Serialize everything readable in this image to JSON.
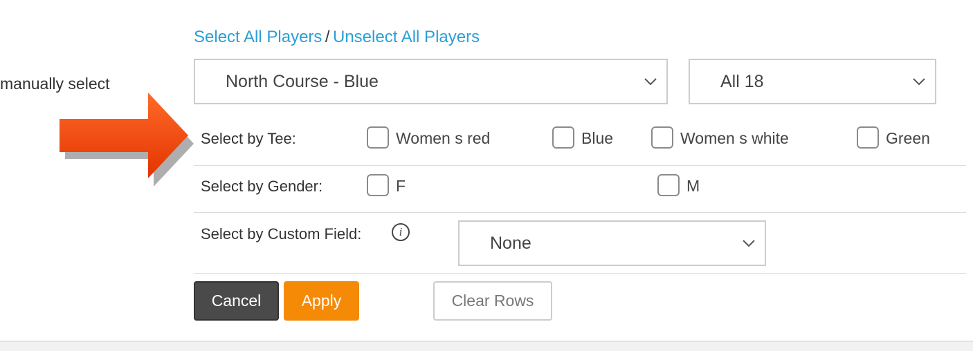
{
  "side_text": "manually select",
  "links": {
    "select_all": "Select All Players",
    "separator": "/",
    "unselect_all": "Unselect All Players"
  },
  "course_select": {
    "value": "North Course - Blue"
  },
  "holes_select": {
    "value": "All 18"
  },
  "tee_row": {
    "label": "Select by Tee:",
    "options": [
      "Women s red",
      "Blue",
      "Women s white",
      "Green"
    ]
  },
  "gender_row": {
    "label": "Select by Gender:",
    "options": [
      "F",
      "M"
    ]
  },
  "custom_row": {
    "label": "Select by Custom Field:",
    "info_icon_glyph": "i",
    "select_value": "None"
  },
  "buttons": {
    "cancel": "Cancel",
    "apply": "Apply",
    "clear": "Clear Rows"
  },
  "colors": {
    "link": "#2a9fd6",
    "apply": "#f58a07",
    "cancel": "#4a4a4a",
    "arrow": "#f0400a"
  },
  "icons": {
    "arrow": "right-arrow-icon",
    "chevron": "chevron-down-icon",
    "info": "info-icon"
  }
}
